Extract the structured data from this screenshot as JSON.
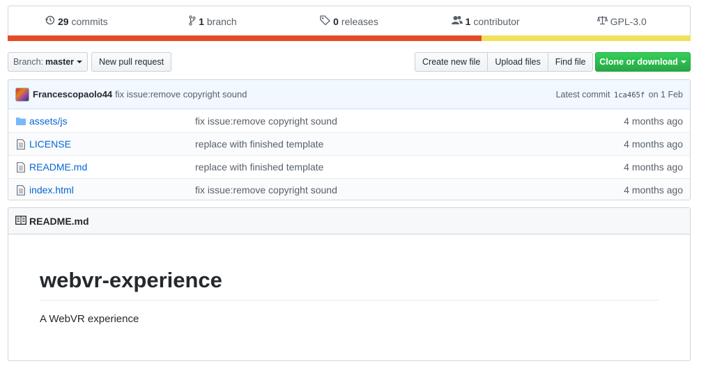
{
  "summary": {
    "commits": {
      "num": "29",
      "label": "commits",
      "icon": "history-icon"
    },
    "branches": {
      "num": "1",
      "label": "branch",
      "icon": "git-branch-icon"
    },
    "releases": {
      "num": "0",
      "label": "releases",
      "icon": "tag-icon"
    },
    "contributors": {
      "num": "1",
      "label": "contributor",
      "icon": "people-icon"
    },
    "license": {
      "label": "GPL-3.0",
      "icon": "law-icon"
    },
    "languages": [
      {
        "color": "#e34c26",
        "percent": 69.4
      },
      {
        "color": "#f1e05a",
        "percent": 30.6
      }
    ]
  },
  "toolbar": {
    "branch_prefix": "Branch:",
    "branch_name": "master",
    "new_pr": "New pull request",
    "create_file": "Create new file",
    "upload_files": "Upload files",
    "find_file": "Find file",
    "clone": "Clone or download"
  },
  "latest_commit": {
    "author": "Francescopaolo44",
    "message": "fix issue:remove copyright sound",
    "prefix": "Latest commit",
    "sha": "1ca465f",
    "date": "on 1 Feb"
  },
  "files": [
    {
      "name": "assets/js",
      "type": "folder",
      "message": "fix issue:remove copyright sound",
      "age": "4 months ago"
    },
    {
      "name": "LICENSE",
      "type": "file",
      "message": "replace with finished template",
      "age": "4 months ago"
    },
    {
      "name": "README.md",
      "type": "file",
      "message": "replace with finished template",
      "age": "4 months ago"
    },
    {
      "name": "index.html",
      "type": "file",
      "message": "fix issue:remove copyright sound",
      "age": "4 months ago"
    }
  ],
  "readme": {
    "filename": "README.md",
    "title": "webvr-experience",
    "description": "A WebVR experience"
  }
}
